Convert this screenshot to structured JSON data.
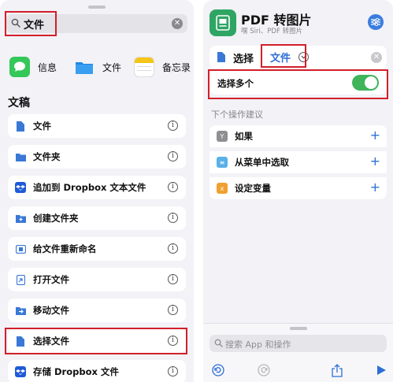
{
  "left": {
    "search": {
      "query": "文件"
    },
    "apps": [
      {
        "label": "信息",
        "icon": "messages-app-icon",
        "color": "#34c759"
      },
      {
        "label": "文件",
        "icon": "files-app-icon",
        "color": "#1e88e5"
      },
      {
        "label": "备忘录",
        "icon": "notes-app-icon",
        "color": "#f5c518"
      }
    ],
    "section_title": "文稿",
    "items": [
      {
        "label": "文件",
        "icon": "file-icon"
      },
      {
        "label": "文件夹",
        "icon": "folder-icon"
      },
      {
        "label": "追加到 Dropbox 文本文件",
        "icon": "dropbox-icon"
      },
      {
        "label": "创建文件夹",
        "icon": "create-folder-icon"
      },
      {
        "label": "给文件重新命名",
        "icon": "rename-file-icon"
      },
      {
        "label": "打开文件",
        "icon": "open-file-icon"
      },
      {
        "label": "移动文件",
        "icon": "move-file-icon"
      },
      {
        "label": "选择文件",
        "icon": "select-file-icon"
      },
      {
        "label": "存储 Dropbox 文件",
        "icon": "dropbox-icon"
      }
    ]
  },
  "right": {
    "shortcut": {
      "title": "PDF 转图片",
      "subtitle": "嘿 Siri、PDF 转图片"
    },
    "action": {
      "label": "选择",
      "token": "文件"
    },
    "option": {
      "label": "选择多个",
      "enabled": true
    },
    "suggestions_title": "下个操作建议",
    "suggestions": [
      {
        "label": "如果",
        "icon": "if-branch-icon",
        "color": "#8e8e93"
      },
      {
        "label": "从菜单中选取",
        "icon": "menu-icon",
        "color": "#5ab0e8"
      },
      {
        "label": "设定变量",
        "icon": "variable-icon",
        "color": "#f0a030"
      }
    ],
    "bottom_search": {
      "placeholder": "搜索 App 和操作"
    }
  },
  "colors": {
    "accent": "#2d6fd6",
    "highlight": "#d21f2a",
    "toggle_on": "#3fb45a"
  }
}
